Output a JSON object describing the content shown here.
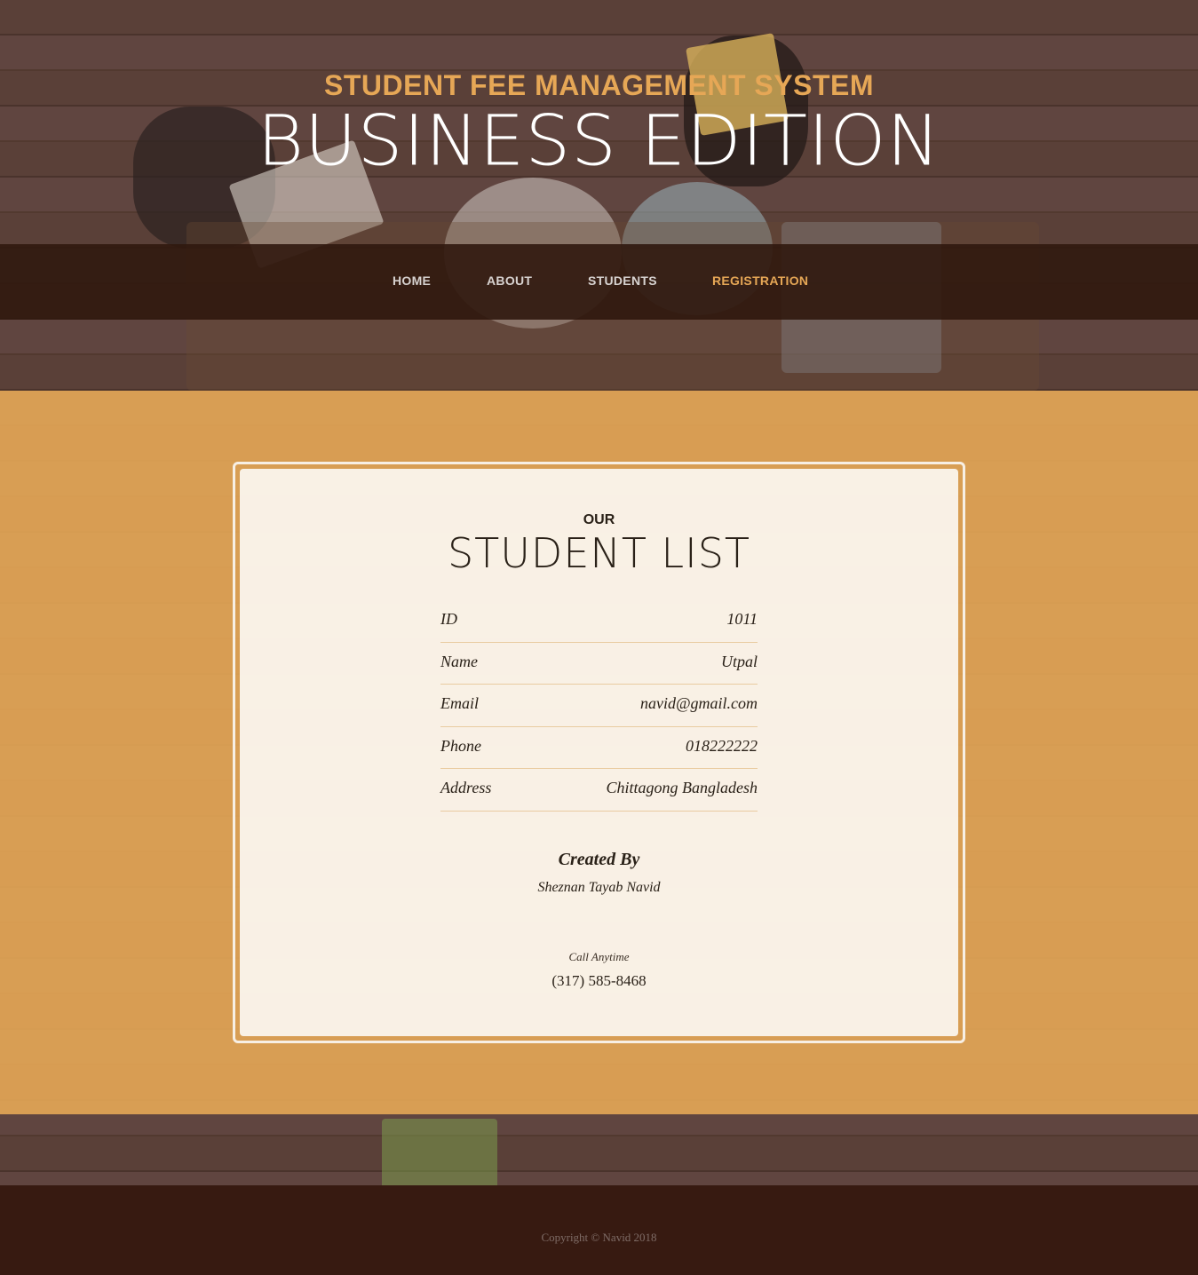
{
  "header": {
    "upper": "Student Fee Management System",
    "lower": "Business Edition"
  },
  "nav": {
    "items": [
      {
        "label": "Home",
        "active": false
      },
      {
        "label": "About",
        "active": false
      },
      {
        "label": "Students",
        "active": false
      },
      {
        "label": "Registration",
        "active": true
      }
    ]
  },
  "section": {
    "heading_upper": "Our",
    "heading_lower": "Student List",
    "fields": [
      {
        "label": "ID",
        "value": "1011"
      },
      {
        "label": "Name",
        "value": "Utpal"
      },
      {
        "label": "Email",
        "value": "navid@gmail.com"
      },
      {
        "label": "Phone",
        "value": "018222222"
      },
      {
        "label": "Address",
        "value": "Chittagong Bangladesh"
      }
    ],
    "created_by_title": "Created By",
    "created_by_name": "Sheznan Tayab Navid",
    "call_label": "Call Anytime",
    "call_phone": "(317) 585-8468"
  },
  "footer": {
    "copyright": "Copyright © Navid 2018"
  },
  "colors": {
    "accent": "#e6a756",
    "nav_bg": "#30180e",
    "footer_bg": "#371a11",
    "section_bg": "#e6a756"
  }
}
